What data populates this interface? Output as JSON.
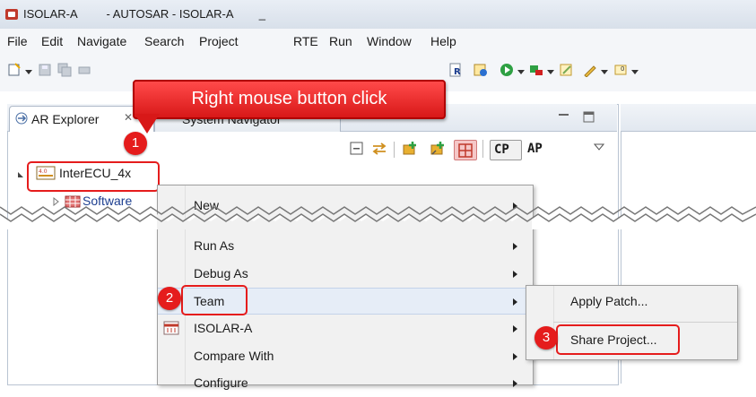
{
  "window": {
    "title": "ISOLAR-A         - AUTOSAR - ISOLAR-A        _"
  },
  "menubar": {
    "items": [
      "File",
      "Edit",
      "Navigate",
      "Search",
      "Project",
      "RTE",
      "Run",
      "Window",
      "Help"
    ]
  },
  "callout": {
    "text": "Right mouse button click"
  },
  "tabs": {
    "ar_explorer": "AR Explorer",
    "ar_explorer_close": "✕",
    "system_navigator": "System Navigator"
  },
  "view_toolbar": {
    "cp": "CP",
    "ap": "AP"
  },
  "tree": {
    "root": "InterECU_4x",
    "child": "Software"
  },
  "context_menu": {
    "items": [
      {
        "label": "New",
        "submenu": true
      },
      {
        "label": "Run As",
        "submenu": true
      },
      {
        "label": "Debug As",
        "submenu": true
      },
      {
        "label": "Team",
        "submenu": true
      },
      {
        "label": "ISOLAR-A",
        "submenu": true
      },
      {
        "label": "Compare With",
        "submenu": true
      },
      {
        "label": "Configure",
        "submenu": true
      }
    ]
  },
  "submenu": {
    "items": [
      "Apply Patch...",
      "Share Project..."
    ]
  },
  "steps": [
    "1",
    "2",
    "3"
  ],
  "colors": {
    "accent_red": "#e51c1c",
    "callout_red": "#d81818"
  }
}
